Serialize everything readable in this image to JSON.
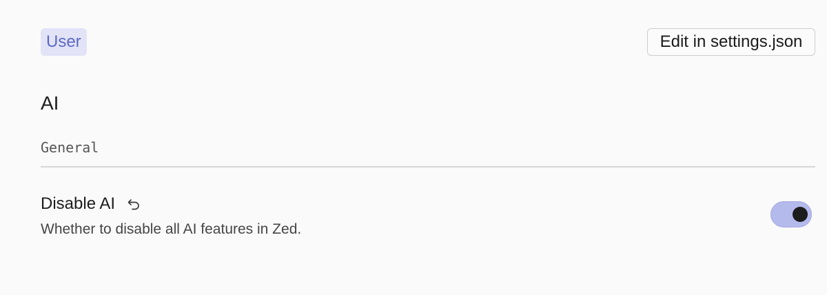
{
  "header": {
    "scope_label": "User",
    "edit_button_label": "Edit in settings.json"
  },
  "section": {
    "title": "AI",
    "group_label": "General"
  },
  "settings": [
    {
      "label": "Disable AI",
      "description": "Whether to disable all AI features in Zed.",
      "reset_icon": "reset-arrow-icon",
      "enabled": true
    }
  ],
  "colors": {
    "accent": "#5d68c4",
    "badge_bg": "#e2e3f7",
    "toggle_on_bg": "#b5baed"
  }
}
